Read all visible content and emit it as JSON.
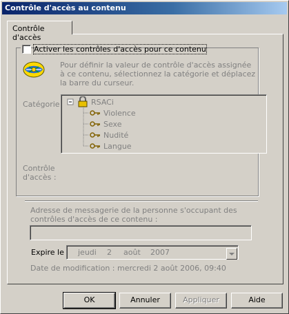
{
  "window": {
    "title": "Contrôle d'accès au contenu"
  },
  "tab": {
    "label": "Contrôle d'accès"
  },
  "enable": {
    "label": "Activer les contrôles d'accès pour ce contenu",
    "checked": false
  },
  "description": "Pour définir la valeur de contrôle d'accès assignée à ce contenu, sélectionnez la catégorie et déplacez la barre du curseur.",
  "category_label": "Catégorie :",
  "tree": {
    "root": "RSACi",
    "expander": "−",
    "items": [
      "Violence",
      "Sexe",
      "Nudité",
      "Langue"
    ]
  },
  "access_label": "Contrôle d'accès :",
  "email": {
    "label": "Adresse de messagerie de la personne s'occupant des contrôles d'accès de ce contenu :",
    "value": ""
  },
  "expire": {
    "label": "Expire le :",
    "weekday": "jeudi",
    "day": "2",
    "month": "août",
    "year": "2007"
  },
  "modified": "Date de modification :   mercredi 2 août 2006, 09:40",
  "buttons": {
    "ok": "OK",
    "cancel": "Annuler",
    "apply": "Appliquer",
    "help": "Aide"
  },
  "icons": {
    "rsac_logo": "rsac-logo-icon",
    "lock": "lock-icon",
    "key": "key-icon"
  },
  "colors": {
    "title_start": "#0a246a",
    "title_end": "#a6caf0",
    "face": "#d4d0c8"
  }
}
